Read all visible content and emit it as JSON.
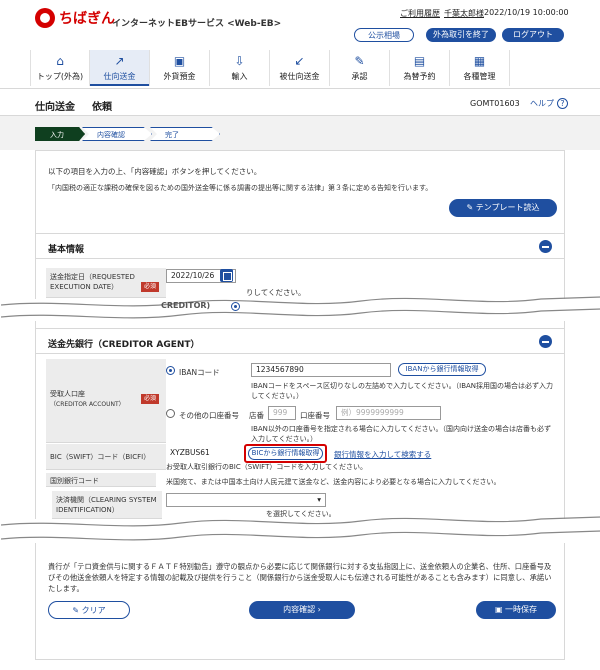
{
  "header": {
    "logo_text": "ちばぎん",
    "service_name": "インターネットEBサービス <Web-EB>",
    "usage_history_link": "ご利用履歴",
    "user_name": "千葉太郎様",
    "datetime": "2022/10/19 10:00:00",
    "rate_button": "公示相場",
    "end_fx_button": "外為取引を終了",
    "logout_button": "ログアウト"
  },
  "nav": [
    {
      "label": "トップ(外為)",
      "icon": "home-icon"
    },
    {
      "label": "仕向送金",
      "icon": "send-money-icon"
    },
    {
      "label": "外貨預金",
      "icon": "deposit-icon"
    },
    {
      "label": "輸入",
      "icon": "import-icon"
    },
    {
      "label": "被仕向送金",
      "icon": "receive-money-icon"
    },
    {
      "label": "承認",
      "icon": "approve-icon"
    },
    {
      "label": "為替予約",
      "icon": "fx-reserve-icon"
    },
    {
      "label": "各種管理",
      "icon": "management-icon"
    }
  ],
  "page": {
    "title": "仕向送金",
    "subtitle": "依頼",
    "screen_id": "GOMT01603",
    "help_label": "ヘルプ",
    "help_icon_text": "?"
  },
  "steps": [
    "入力",
    "内容確認",
    "完了"
  ],
  "intro": {
    "line1": "以下の項目を入力の上、「内容確認」ボタンを押してください。",
    "line2": "「内国税の適正な課税の確保を図るための国外送金等に係る調書の提出等に関する法律」第３条に定める告知を行います。",
    "template_button": "テンプレート読込"
  },
  "basic": {
    "section_title": "基本情報",
    "date_label": "送金指定日（REQUESTED EXECUTION DATE）",
    "required": "必須",
    "date_value": "2022/10/26",
    "date_hint": "りしてください。",
    "partial_label": "CREDITOR)",
    "partial_help": "?"
  },
  "bank": {
    "section_title": "送金先銀行（CREDITOR AGENT）",
    "account_label": "受取人口座",
    "account_label2": "（CREDITOR ACCOUNT）",
    "required": "必須",
    "iban_label": "IBANコード",
    "iban_value": "1234567890",
    "iban_button": "IBANから銀行情報取得",
    "iban_hint": "IBANコードをスペース区切りなしの左詰めで入力してください。（IBAN採用国の場合は必ず入力してください。）",
    "other_label": "その他の口座番号",
    "branch_label": "店番",
    "branch_placeholder": "999",
    "acct_no_label": "口座番号",
    "acct_no_placeholder": "例）9999999999",
    "other_hint": "IBAN以外の口座番号を指定される場合に入力してください。（国内向け送金の場合は店番も必ず入力してください。）",
    "bic_label": "BIC（SWIFT）コード（BICFI）",
    "bic_value": "XYZBUS61",
    "bic_button": "BICから銀行情報取得",
    "bank_search_link": "銀行情報を入力して検索する",
    "bic_hint": "お受取人取引銀行のBIC（SWIFT）コードを入力してください。",
    "national_label": "国別銀行コード",
    "national_hint": "米国宛て、または中国本土向け人民元建て送金など、送金内容により必要となる場合に入力してください。",
    "clearing_label": "決済機関（CLEARING SYSTEM IDENTIFICATION）",
    "clearing_hint": "を選択してください。"
  },
  "notice": "貴行が「テロ資金供与に関するＦＡＴＦ特別勧告」遵守の観点から必要に応じて関係銀行に対する支払指図上に、送金依頼人の企業名、住所、口座番号及びその他送金依頼人を特定する情報の記載及び提供を行うこと（関係銀行から送金受取人にも伝達される可能性があることも含みます）に同意し、承諾いたします。",
  "buttons": {
    "clear": "クリア",
    "confirm": "内容確認",
    "save": "一時保存"
  },
  "colors": {
    "brand_red": "#d40000",
    "primary_blue": "#1f4fa0",
    "step_active": "#0f3f1f"
  }
}
